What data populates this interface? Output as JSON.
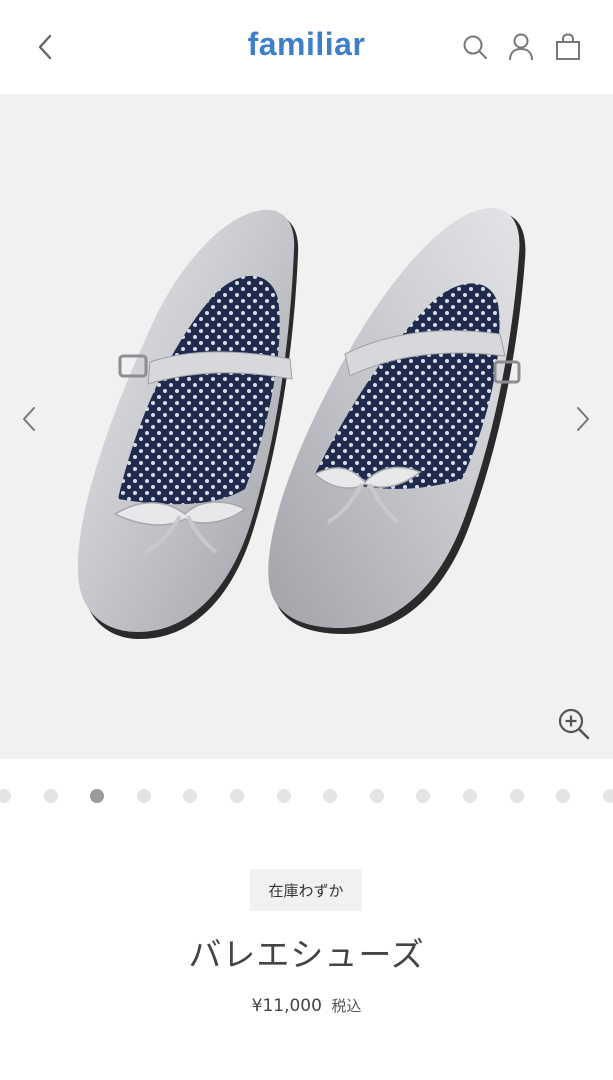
{
  "header": {
    "logo": "familiar",
    "brand_color": "#3f7ec8",
    "icons": [
      "chevron-left-icon",
      "search-icon",
      "user-icon",
      "shopping-bag-icon"
    ]
  },
  "gallery": {
    "background": "#f1f1f1",
    "icons": [
      "chevron-left-icon",
      "chevron-right-icon",
      "zoom-in-icon"
    ],
    "slide_count": 14,
    "active_slide": 2
  },
  "product": {
    "stock_badge": "在庫わずか",
    "name": "バレエシューズ",
    "price": "¥11,000",
    "tax_label": "税込"
  }
}
